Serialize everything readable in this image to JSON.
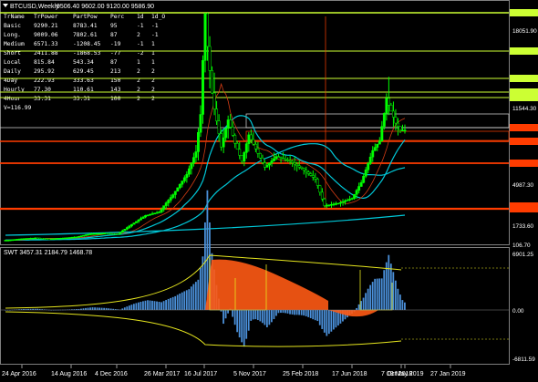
{
  "window": {
    "title": "BTCUSD,Weekly",
    "ohlc": "9506.40 9602.00 9120.00 9586.90"
  },
  "info_table": {
    "headers": [
      "TrName",
      "TrPower",
      "PartPow",
      "Perc",
      "1d",
      "1d_O"
    ],
    "rows": [
      [
        "Basic",
        "9290.21",
        "8783.41",
        "95",
        "-1",
        "-1"
      ],
      [
        "Long.",
        "9009.06",
        "7802.61",
        "87",
        "2",
        "-1"
      ],
      [
        "Medium",
        "6571.33",
        "-1208.45",
        "-19",
        "-1",
        "1"
      ],
      [
        "Short",
        "2411.88",
        "-1868.53",
        "-77",
        "-2",
        "1"
      ],
      [
        "Local",
        "815.84",
        "543.34",
        "87",
        "1",
        "1"
      ],
      [
        "Daily",
        "295.92",
        "629.45",
        "213",
        "2",
        "2"
      ],
      [
        "4Day",
        "222.93",
        "333.63",
        "150",
        "2",
        "2"
      ],
      [
        "Hourly",
        "77.30",
        "110.61",
        "143",
        "2",
        "2"
      ],
      [
        "4Hour",
        "33.31",
        "33.31",
        "100",
        "2",
        "2"
      ]
    ],
    "footer": "V=116.99"
  },
  "price_axis": {
    "labels": [
      "19474.00",
      "18051.90",
      "16319.07",
      "13057.20",
      "12829.87",
      "12358.66",
      "11544.30",
      "9787.85",
      "8671.17",
      "6841.05",
      "4987.30",
      "3269.80",
      "3121.60",
      "1733.60",
      "106.70"
    ]
  },
  "indicator": {
    "title": "SWT 3457.31 2184.79 1468.78",
    "axis_labels": [
      "6901.25",
      "0.00",
      "-6811.59"
    ]
  },
  "time_axis": {
    "labels": [
      "24 Apr 2016",
      "14 Aug 2016",
      "4 Dec 2016",
      "26 Mar 2017",
      "16 Jul 2017",
      "5 Nov 2017",
      "25 Feb 2018",
      "17 Jun 2018",
      "7 Oct 2018",
      "27 Jan 2019",
      "19 May 2019"
    ]
  },
  "colors": {
    "background": "#000000",
    "candle_up": "#00ff00",
    "candle_down": "#000000",
    "level_lime": "#ccff33",
    "level_orange": "#ff4000",
    "ma_cyan": "#00c8d8",
    "ma_red": "#d23c14",
    "osc_orange": "#ff5a14",
    "osc_blue": "#4a8fd8",
    "osc_band": "#e6e61e"
  },
  "chart_data": {
    "type": "line",
    "title": "BTCUSD,Weekly",
    "series": [
      {
        "x": [
          "2016-04-24",
          "2016-06-05",
          "2016-07-17",
          "2016-08-28",
          "2016-10-09",
          "2016-11-20",
          "2017-01-01",
          "2017-02-12",
          "2017-03-26",
          "2017-05-07",
          "2017-06-18",
          "2017-07-30",
          "2017-09-10",
          "2017-10-22",
          "2017-11-19",
          "2017-12-03",
          "2017-12-17",
          "2017-12-31",
          "2018-01-14",
          "2018-02-04",
          "2018-02-25",
          "2018-03-18",
          "2018-04-08",
          "2018-04-29",
          "2018-06-17",
          "2018-07-22",
          "2018-09-02",
          "2018-10-07",
          "2018-11-18",
          "2018-12-16",
          "2019-01-27",
          "2019-03-10",
          "2019-04-07",
          "2019-05-12",
          "2019-06-02",
          "2019-06-23",
          "2019-07-07",
          "2019-07-21",
          "2019-08-04"
        ],
        "y": [
          460,
          580,
          650,
          575,
          640,
          740,
          1000,
          1050,
          1000,
          1800,
          2550,
          2850,
          4200,
          5900,
          7800,
          11000,
          19400,
          14000,
          11500,
          8200,
          10500,
          8500,
          7000,
          9200,
          6500,
          7400,
          7000,
          6400,
          5500,
          3300,
          3500,
          3900,
          5200,
          7900,
          8700,
          12300,
          11300,
          10200,
          9586.9
        ]
      }
    ],
    "levels": [
      19474.0,
      16319.07,
      13057.2,
      12829.87,
      12358.66,
      9787.85,
      8671.17,
      6841.05,
      3269.8,
      3121.6
    ],
    "ylim": [
      106.7,
      19474.0
    ],
    "xlabel": "",
    "ylabel": "",
    "indicator": {
      "name": "SWT",
      "values": [
        3457.31,
        2184.79,
        1468.78
      ],
      "ylim": [
        -6811.59,
        6901.25
      ]
    },
    "grid": false,
    "legend": "top-left"
  }
}
